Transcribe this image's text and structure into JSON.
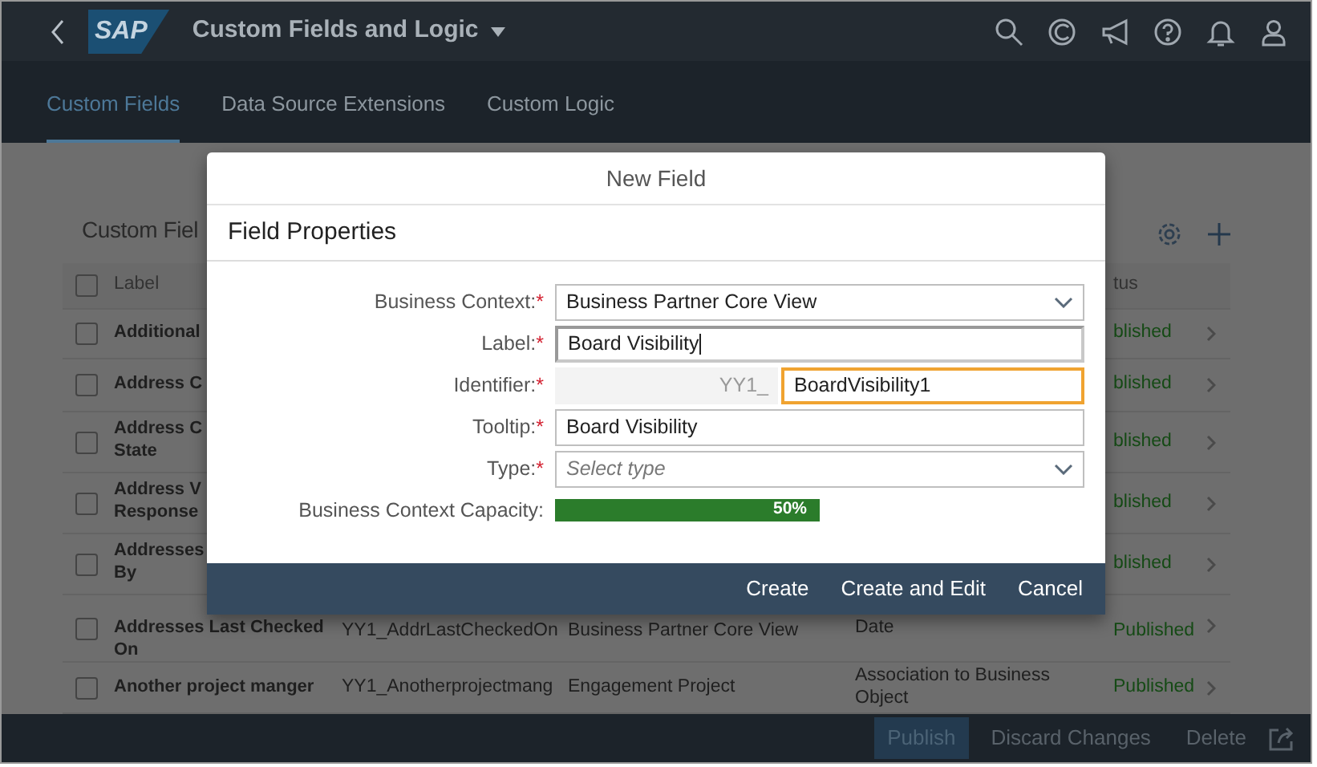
{
  "shell": {
    "logo": "SAP",
    "title": "Custom Fields and Logic"
  },
  "tabs": [
    {
      "label": "Custom Fields",
      "selected": true
    },
    {
      "label": "Data Source Extensions",
      "selected": false
    },
    {
      "label": "Custom Logic",
      "selected": false
    }
  ],
  "list": {
    "title": "Custom Fiel",
    "select_all": {
      "checked": false
    },
    "columns": [
      "Label",
      "tus"
    ],
    "rows": [
      {
        "label": "Additional",
        "status": "blished",
        "checked": false
      },
      {
        "label": "Address C",
        "status": "blished",
        "checked": false
      },
      {
        "label": "Address C\nState",
        "status": "blished",
        "checked": false
      },
      {
        "label": "Address V\nResponse",
        "status": "blished",
        "checked": false
      },
      {
        "label": "Addresses\nBy",
        "status": "blished",
        "checked": false
      },
      {
        "label": "Addresses Last Checked\nOn",
        "identifier": "YY1_AddrLastCheckedOn",
        "context": "Business Partner Core View",
        "type": "Date",
        "status": "Published",
        "checked": false
      },
      {
        "label": "Another project manger",
        "identifier": "YY1_Anotherprojectmang",
        "context": "Engagement Project",
        "type": "Association to Business Object",
        "status": "Published",
        "checked": false
      }
    ]
  },
  "dialog": {
    "title": "New Field",
    "section": "Field Properties",
    "fields": [
      {
        "kind": "select",
        "label": "Business Context:",
        "mark": "*",
        "value": "Business Partner Core View"
      },
      {
        "kind": "text",
        "label": "Label:",
        "mark": "*",
        "value": "Board Visibility",
        "focused": true
      },
      {
        "kind": "identifier",
        "label": "Identifier:",
        "mark": "*",
        "prefix": "YY1_",
        "value": "BoardVisibility1",
        "warning": true
      },
      {
        "kind": "text",
        "label": "Tooltip:",
        "mark": "*",
        "value": "Board Visibility",
        "focused": false
      },
      {
        "kind": "select",
        "label": "Type:",
        "mark": "*",
        "placeholder": "Select type"
      },
      {
        "kind": "meter",
        "label": "Business Context Capacity:",
        "level": 0.5,
        "reading": "50%"
      }
    ],
    "buttons": [
      "Create",
      "Create and Edit",
      "Cancel"
    ]
  },
  "footer": {
    "buttons": [
      {
        "label": "Publish",
        "emphasized": true
      },
      {
        "label": "Discard Changes",
        "emphasized": false
      },
      {
        "label": "Delete",
        "emphasized": false
      }
    ]
  }
}
